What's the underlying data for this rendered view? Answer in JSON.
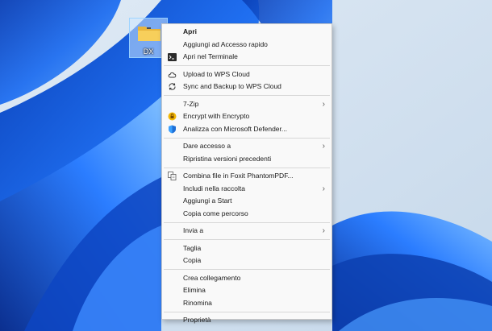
{
  "desktop_icon": {
    "label": "DX",
    "icon": "folder-icon"
  },
  "colors": {
    "menu_bg": "#f9f9f9",
    "menu_border": "#c9c9c9",
    "wallpaper_blue": "#1f63e0"
  },
  "menu": {
    "groups": [
      [
        {
          "label": "Apri",
          "bold": true
        },
        {
          "label": "Aggiungi ad Accesso rapido"
        },
        {
          "label": "Apri nel Terminale",
          "icon": "terminal-icon"
        }
      ],
      [
        {
          "label": "Upload to WPS Cloud",
          "icon": "cloud-icon"
        },
        {
          "label": "Sync and Backup to WPS Cloud",
          "icon": "sync-icon"
        }
      ],
      [
        {
          "label": "7-Zip",
          "submenu": true
        },
        {
          "label": "Encrypt with Encrypto",
          "icon": "encrypto-icon"
        },
        {
          "label": "Analizza con Microsoft Defender...",
          "icon": "defender-shield-icon"
        }
      ],
      [
        {
          "label": "Dare accesso a",
          "submenu": true
        },
        {
          "label": "Ripristina versioni precedenti"
        }
      ],
      [
        {
          "label": "Combina file in Foxit PhantomPDF...",
          "icon": "foxit-combine-icon"
        },
        {
          "label": "Includi nella raccolta",
          "submenu": true
        },
        {
          "label": "Aggiungi a Start"
        },
        {
          "label": "Copia come percorso"
        }
      ],
      [
        {
          "label": "Invia a",
          "submenu": true
        }
      ],
      [
        {
          "label": "Taglia"
        },
        {
          "label": "Copia"
        }
      ],
      [
        {
          "label": "Crea collegamento"
        },
        {
          "label": "Elimina"
        },
        {
          "label": "Rinomina"
        }
      ],
      [
        {
          "label": "Proprietà"
        }
      ]
    ]
  }
}
